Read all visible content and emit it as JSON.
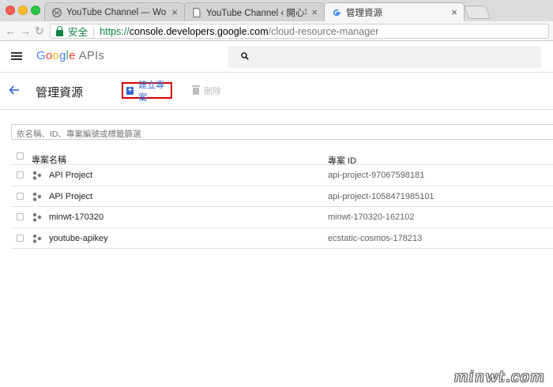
{
  "browser": {
    "tabs": [
      {
        "title": "YouTube Channel — WordPress",
        "favicon": "wordpress-icon",
        "active": false
      },
      {
        "title": "YouTube Channel ‹ 開心容場 — W",
        "favicon": "page-icon",
        "active": false
      },
      {
        "title": "管理資源",
        "favicon": "google-g-icon",
        "active": true
      }
    ],
    "close_glyph": "×",
    "address": {
      "secure_label": "安全",
      "url_scheme": "https://",
      "url_host": "console.developers.google.com",
      "url_path": "/cloud-resource-manager"
    }
  },
  "header": {
    "logo_letters": [
      "G",
      "o",
      "o",
      "g",
      "l",
      "e"
    ],
    "logo_suffix": "APIs"
  },
  "toolbar": {
    "page_title": "管理資源",
    "create_label": "建立專案",
    "delete_label": "刪除"
  },
  "filter": {
    "placeholder": "依名稱、ID、專案編號或標籤篩選"
  },
  "table": {
    "columns": [
      "專案名稱",
      "專案 ID"
    ],
    "rows": [
      {
        "name": "API Project",
        "id": "api-project-97067598181"
      },
      {
        "name": "API Project",
        "id": "api-project-1058471985101"
      },
      {
        "name": "minwt-170320",
        "id": "minwt-170320-162102"
      },
      {
        "name": "youtube-apikey",
        "id": "ecstatic-cosmos-178213"
      }
    ]
  },
  "watermark": "minwt.com",
  "colors": {
    "accent": "#3367d6",
    "highlight_border": "#d50000",
    "secure_green": "#0b8043"
  }
}
